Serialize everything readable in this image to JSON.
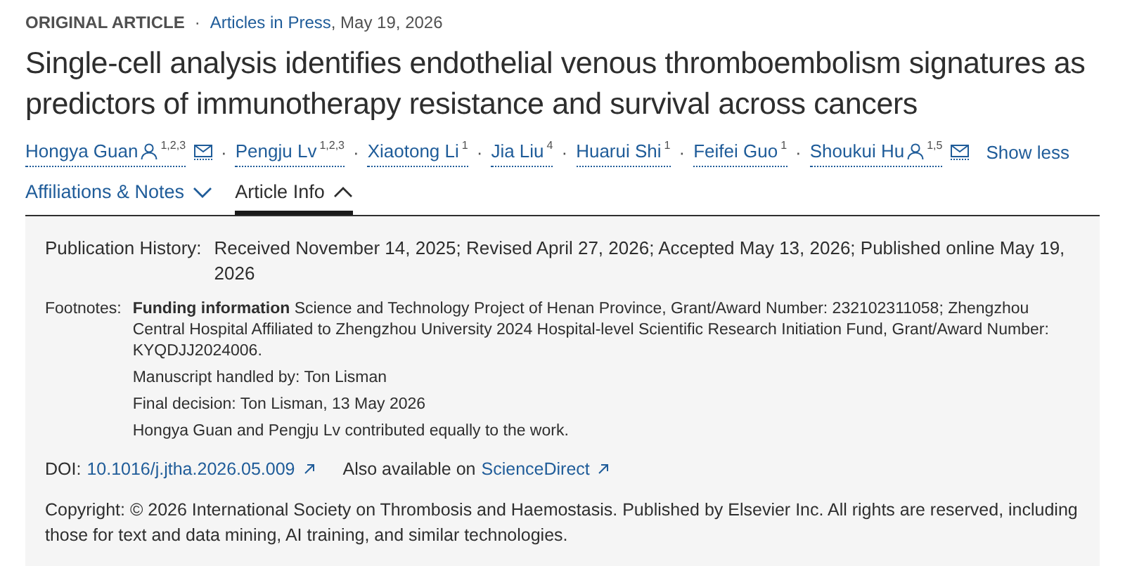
{
  "header": {
    "type": "ORIGINAL ARTICLE",
    "separator": "·",
    "source_link": "Articles in Press",
    "date": ", May 19, 2026"
  },
  "title": "Single-cell analysis identifies endothelial venous thromboembolism signatures as predictors of immunotherapy resistance and survival across cancers",
  "authors": [
    {
      "name": "Hongya Guan",
      "corresponding": true,
      "sup": "1,2,3",
      "email": true
    },
    {
      "name": "Pengju Lv",
      "corresponding": false,
      "sup": "1,2,3",
      "email": false
    },
    {
      "name": "Xiaotong Li",
      "corresponding": false,
      "sup": "1",
      "email": false
    },
    {
      "name": "Jia Liu",
      "corresponding": false,
      "sup": "4",
      "email": false
    },
    {
      "name": "Huarui Shi",
      "corresponding": false,
      "sup": "1",
      "email": false
    },
    {
      "name": "Feifei Guo",
      "corresponding": false,
      "sup": "1",
      "email": false
    },
    {
      "name": "Shoukui Hu",
      "corresponding": true,
      "sup": "1,5",
      "email": true
    }
  ],
  "author_separator": "·",
  "show_less": "Show less",
  "tabs": [
    {
      "label": "Affiliations & Notes",
      "selected": false,
      "expanded": false
    },
    {
      "label": "Article Info",
      "selected": true,
      "expanded": true
    }
  ],
  "article_info": {
    "publication_history_label": "Publication History:",
    "publication_history": "Received November 14, 2025; Revised April 27, 2026; Accepted May 13, 2026; Published online May 19, 2026",
    "footnotes_label": "Footnotes:",
    "footnotes": [
      "**Funding information** Science and Technology Project of Henan Province, Grant/Award Number: 232102311058; Zhengzhou Central Hospital Affiliated to Zhengzhou University 2024 Hospital-level Scientific Research Initiation Fund, Grant/Award Number: KYQDJJ2024006.",
      "Manuscript handled by: Ton Lisman",
      "Final decision: Ton Lisman, 13 May 2026",
      "Hongya Guan and Pengju Lv contributed equally to the work."
    ],
    "doi_label": "DOI:",
    "doi": "10.1016/j.jtha.2026.05.009",
    "also_label": "Also available on",
    "also_link": "ScienceDirect",
    "copyright": "Copyright: © 2026 International Society on Thrombosis and Haemostasis. Published by Elsevier Inc. All rights are reserved, including those for text and data mining, AI training, and similar technologies."
  }
}
